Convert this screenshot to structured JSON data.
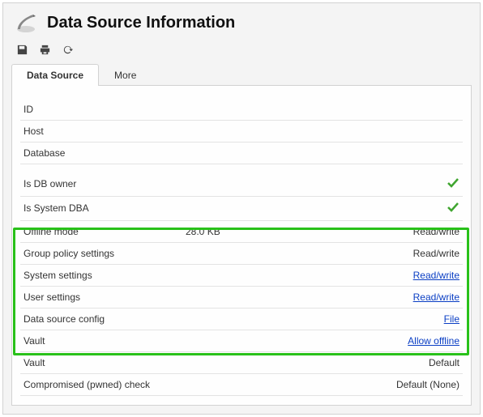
{
  "header": {
    "title": "Data Source Information"
  },
  "tabs": {
    "data_source": "Data Source",
    "more": "More"
  },
  "rows": {
    "id": {
      "label": "ID",
      "value": ""
    },
    "host": {
      "label": "Host",
      "value": ""
    },
    "database": {
      "label": "Database",
      "value": ""
    },
    "is_db_owner": {
      "label": "Is DB owner"
    },
    "is_system_dba": {
      "label": "Is System DBA"
    },
    "offline_mode": {
      "label": "Offline mode",
      "size": "28.0 KB",
      "value": "Read/write"
    },
    "group_policy": {
      "label": "Group policy settings",
      "value": "Read/write"
    },
    "system_settings": {
      "label": "System settings",
      "value": "Read/write"
    },
    "user_settings": {
      "label": "User settings",
      "value": "Read/write"
    },
    "data_source_config": {
      "label": "Data source config",
      "value": "File"
    },
    "vault_offline": {
      "label": "Vault",
      "value": "Allow offline"
    },
    "vault": {
      "label": "Vault",
      "value": "Default"
    },
    "pwned": {
      "label": "Compromised (pwned) check",
      "value": "Default (None)"
    }
  }
}
